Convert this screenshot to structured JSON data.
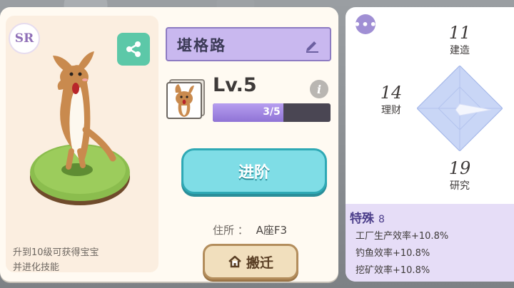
{
  "card": {
    "rarity": "SR",
    "name": "堪格路",
    "level": "Lv.5",
    "xp_text": "3/5",
    "xp_fraction": 0.6,
    "hint_line1": "升到10级可获得宝宝",
    "hint_line2": "并进化技能",
    "advance_label": "进阶",
    "residence_label": "住所",
    "residence_sep": "：",
    "residence_value": "A座F3",
    "move_label": "搬迁"
  },
  "stats": {
    "build": {
      "value": "11",
      "label": "建造"
    },
    "finance": {
      "value": "14",
      "label": "理财"
    },
    "research": {
      "value": "19",
      "label": "研究"
    }
  },
  "special": {
    "title": "特殊",
    "count": "8",
    "items": [
      "工厂生产效率+10.8%",
      "钓鱼效率+10.8%",
      "挖矿效率+10.8%"
    ]
  },
  "colors": {
    "accent": "#c9b8ef",
    "advance": "#7fdde6",
    "share": "#5cc8a8",
    "move": "#f1dfbd"
  },
  "icons": {
    "share": "share-icon",
    "edit": "pencil-icon",
    "info": "info-icon",
    "home": "home-icon",
    "more": "more-icon"
  }
}
